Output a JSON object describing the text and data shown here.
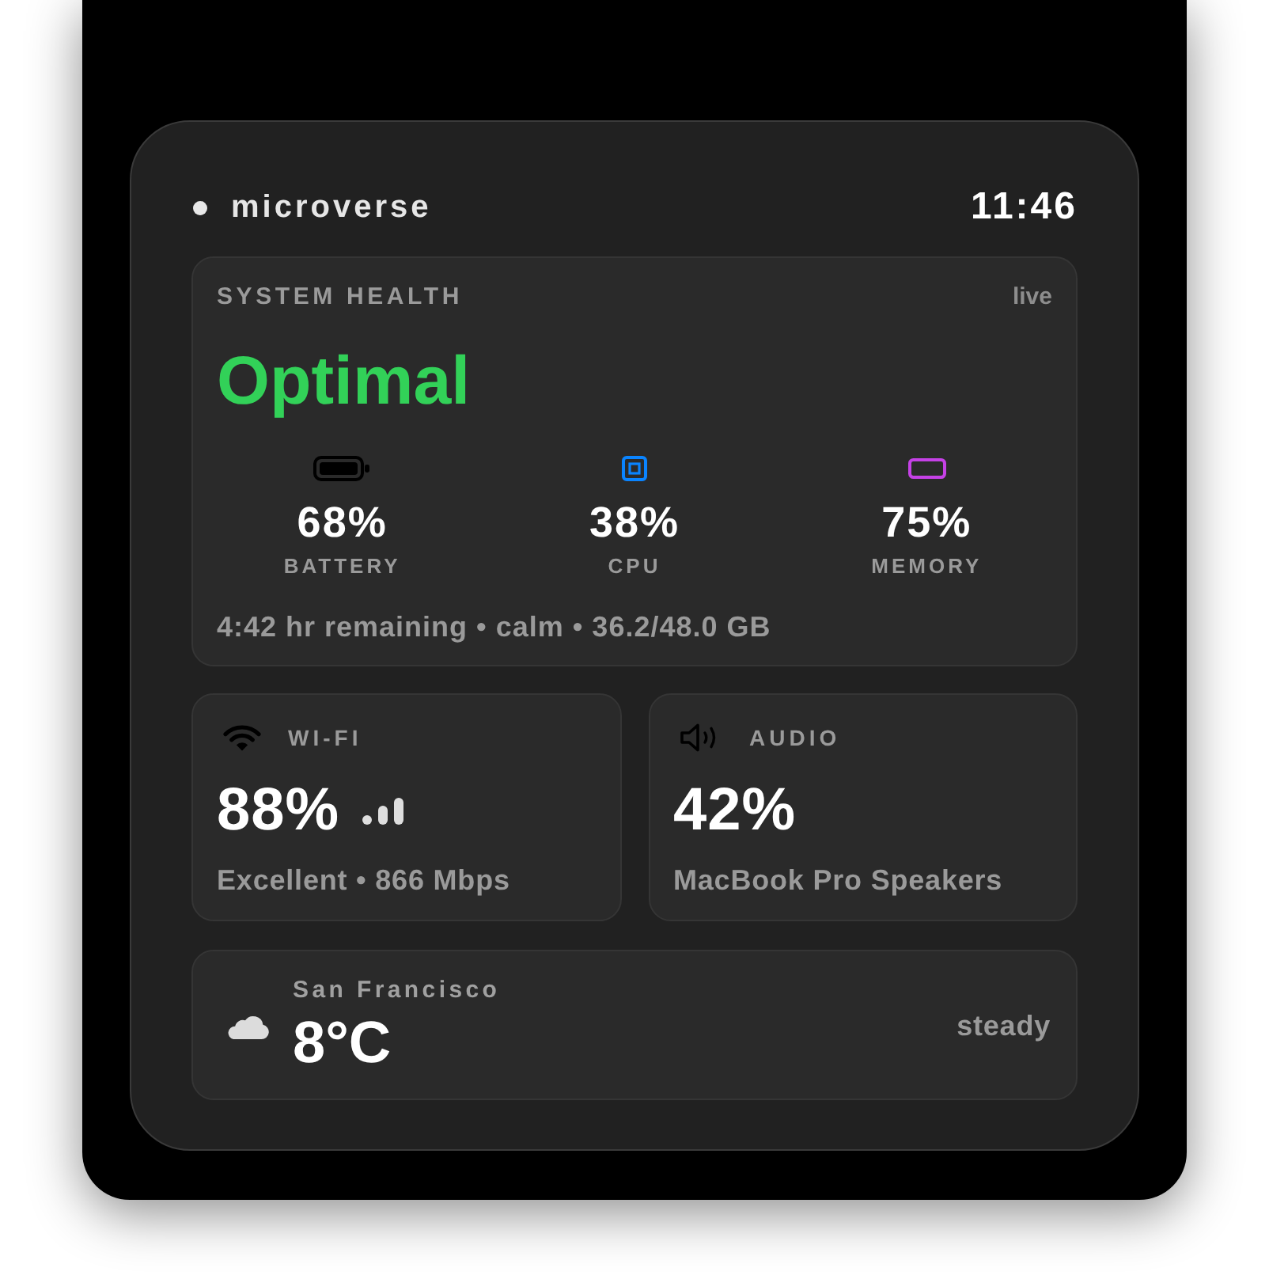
{
  "header": {
    "title": "microverse",
    "time": "11:46"
  },
  "system_health": {
    "title": "SYSTEM HEALTH",
    "badge": "live",
    "status": "Optimal",
    "metrics": [
      {
        "kind": "battery",
        "color": "#000000",
        "value": "68%",
        "label": "BATTERY"
      },
      {
        "kind": "cpu",
        "color": "#0a84ff",
        "value": "38%",
        "label": "CPU"
      },
      {
        "kind": "memory",
        "color": "#c541e6",
        "value": "75%",
        "label": "MEMORY"
      }
    ],
    "summary": "4:42 hr remaining • calm • 36.2/48.0 GB"
  },
  "tiles": [
    {
      "kind": "wifi",
      "title": "WI-FI",
      "value": "88%",
      "detail": "Excellent • 866 Mbps"
    },
    {
      "kind": "audio",
      "title": "AUDIO",
      "value": "42%",
      "detail": "MacBook Pro Speakers"
    }
  ],
  "weather": {
    "location": "San Francisco",
    "temperature": "8°C",
    "trend": "steady"
  }
}
